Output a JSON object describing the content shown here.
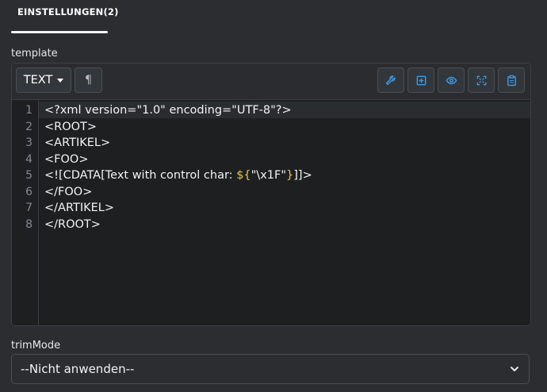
{
  "tabs": [
    {
      "label": "EINSTELLUNGEN(2)",
      "active": true
    }
  ],
  "template_field": {
    "label": "template",
    "mode_button": {
      "label": "TEXT",
      "icon": "caret-down-icon"
    },
    "paragraph_button": {
      "glyph": "¶",
      "icon": "pilcrow-icon"
    },
    "toolbar_icons": [
      "wrench-icon",
      "add-box-icon",
      "eye-icon",
      "fullscreen-icon",
      "clipboard-icon"
    ],
    "line_numbers": [
      "1",
      "2",
      "3",
      "4",
      "5",
      "6",
      "7",
      "8"
    ],
    "lines": [
      {
        "text": "<?xml version=\"1.0\" encoding=\"UTF-8\"?>"
      },
      {
        "text": "<ROOT>"
      },
      {
        "text": "<ARTIKEL>"
      },
      {
        "text": "<FOO>"
      },
      {
        "pre": "<![CDATA[Text with control char: ",
        "expr_open": "${",
        "expr_str": "\"\\x1F\"",
        "expr_close": "}",
        "post": "]]>"
      },
      {
        "text": "</FOO>"
      },
      {
        "text": "</ARTIKEL>"
      },
      {
        "text": "</ROOT>"
      }
    ]
  },
  "trim_field": {
    "label": "trimMode",
    "selected": "--Nicht anwenden--"
  },
  "colors": {
    "background": "#2b2d30",
    "editor_background": "#1d1f21",
    "accent_icon": "#3d9ae6",
    "expression": "#e8c547"
  }
}
